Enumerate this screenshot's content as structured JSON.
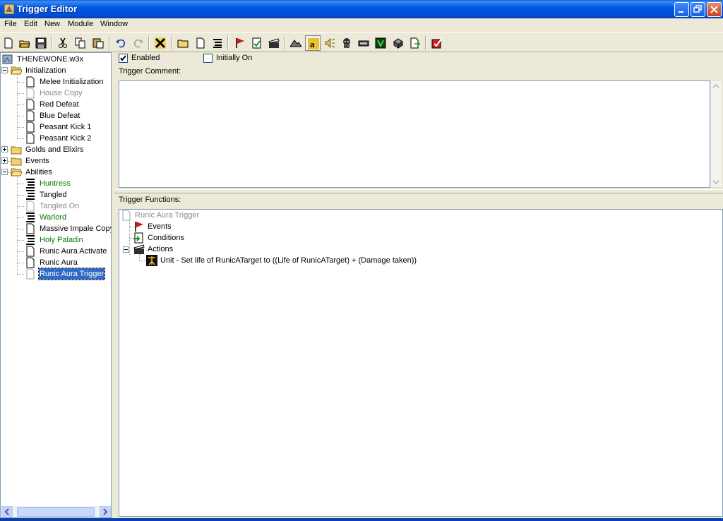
{
  "window": {
    "title": "Trigger Editor"
  },
  "menu": [
    "File",
    "Edit",
    "New",
    "Module",
    "Window"
  ],
  "toolbar": {
    "icons": [
      "new-icon",
      "open-icon",
      "save-icon",
      "cut-icon",
      "copy-icon",
      "paste-icon",
      "undo-icon",
      "redo-icon",
      "delete-icon",
      "new-category-icon",
      "new-trigger-icon",
      "new-comment-icon",
      "new-event-icon",
      "new-condition-icon",
      "new-action-icon",
      "terrain-editor-icon",
      "trigger-editor-icon",
      "sound-editor-icon",
      "object-editor-icon",
      "campaign-editor-icon",
      "ai-editor-icon",
      "object-manager-icon",
      "import-manager-icon",
      "test-map-icon"
    ]
  },
  "tree": {
    "root": "THENEWONE.w3x",
    "items": [
      {
        "label": "Initialization",
        "type": "folder-open",
        "depth": 1,
        "style": "normal"
      },
      {
        "label": "Melee Initialization",
        "type": "trigger",
        "depth": 2,
        "style": "normal"
      },
      {
        "label": "House Copy",
        "type": "trigger",
        "depth": 2,
        "style": "gray"
      },
      {
        "label": "Red Defeat",
        "type": "trigger",
        "depth": 2,
        "style": "normal"
      },
      {
        "label": "Blue Defeat",
        "type": "trigger",
        "depth": 2,
        "style": "normal"
      },
      {
        "label": "Peasant Kick 1",
        "type": "trigger",
        "depth": 2,
        "style": "normal"
      },
      {
        "label": "Peasant Kick 2",
        "type": "trigger",
        "depth": 2,
        "style": "normal"
      },
      {
        "label": "Golds and Elixirs",
        "type": "folder",
        "depth": 1,
        "style": "normal"
      },
      {
        "label": "Events",
        "type": "folder",
        "depth": 1,
        "style": "normal"
      },
      {
        "label": "Abilities",
        "type": "folder-open",
        "depth": 1,
        "style": "normal"
      },
      {
        "label": "Huntress",
        "type": "script",
        "depth": 2,
        "style": "green"
      },
      {
        "label": "Tangled",
        "type": "script",
        "depth": 2,
        "style": "normal"
      },
      {
        "label": "Tangled On",
        "type": "trigger",
        "depth": 2,
        "style": "gray"
      },
      {
        "label": "Warlord",
        "type": "script",
        "depth": 2,
        "style": "green"
      },
      {
        "label": "Massive Impale Copy",
        "type": "trigger",
        "depth": 2,
        "style": "normal"
      },
      {
        "label": "Holy Paladin",
        "type": "script",
        "depth": 2,
        "style": "green"
      },
      {
        "label": "Runic Aura Activate",
        "type": "trigger",
        "depth": 2,
        "style": "normal"
      },
      {
        "label": "Runic Aura",
        "type": "trigger",
        "depth": 2,
        "style": "normal"
      },
      {
        "label": "Runic Aura Trigger",
        "type": "trigger",
        "depth": 2,
        "style": "selected"
      }
    ]
  },
  "editor": {
    "enabled_label": "Enabled",
    "enabled_checked": true,
    "initially_on_label": "Initially On",
    "initially_on_checked": false,
    "comment_label": "Trigger Comment:",
    "functions_label": "Trigger Functions:",
    "functions": {
      "trigger_name": "Runic Aura Trigger",
      "events": "Events",
      "conditions": "Conditions",
      "actions": "Actions",
      "action_items": [
        "Unit - Set life of RunicATarget to ((Life of RunicATarget) + (Damage taken))"
      ]
    }
  }
}
